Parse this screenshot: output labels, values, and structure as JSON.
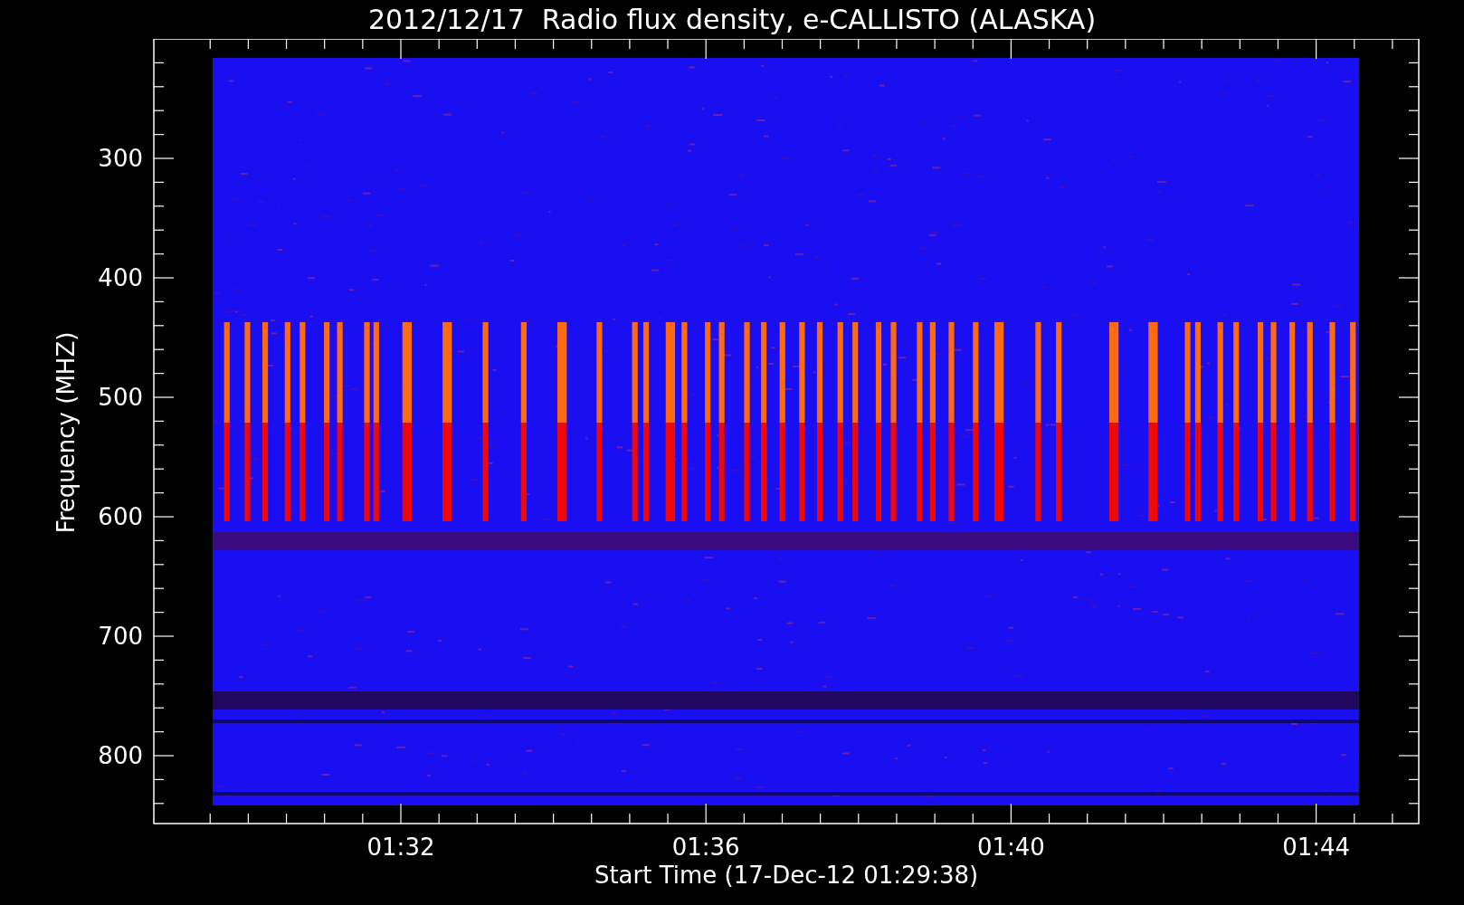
{
  "title": "2012/12/17  Radio flux density, e-CALLISTO (ALASKA)",
  "y_axis": {
    "label": "Frequency (MHZ)",
    "ticks": [
      "300",
      "400",
      "500",
      "600",
      "700",
      "800"
    ]
  },
  "x_axis": {
    "label": "Start Time (17-Dec-12 01:29:38)",
    "ticks": [
      "01:32",
      "01:36",
      "01:40",
      "01:44"
    ]
  }
}
